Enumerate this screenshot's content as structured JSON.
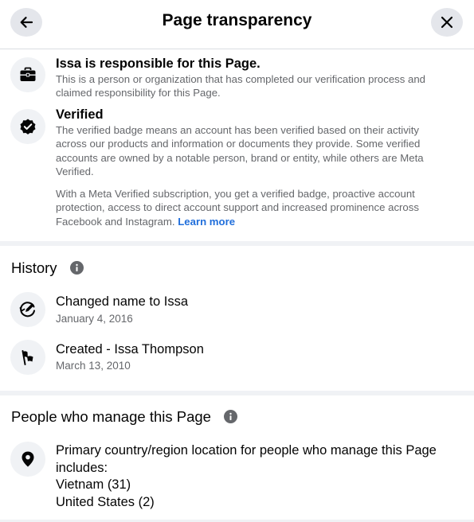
{
  "header": {
    "title": "Page transparency",
    "back_icon": "arrow-left-icon",
    "close_icon": "close-icon"
  },
  "responsibility": {
    "title": "Issa is responsible for this Page.",
    "description": "This is a person or organization that has completed our verification process and claimed responsibility for this Page.",
    "icon": "briefcase-icon"
  },
  "verified": {
    "title": "Verified",
    "description": "The verified badge means an account has been verified based on their activity across our products and information or documents they provide. Some verified accounts are owned by a notable person, brand or entity, while others are Meta Verified.",
    "meta_text": "With a Meta Verified subscription, you get a verified badge, proactive account protection, access to direct account support and increased prominence across Facebook and Instagram.",
    "learn_more": "Learn more",
    "icon": "verified-badge-icon",
    "link_color": "#216fdb"
  },
  "history": {
    "title": "History",
    "info_icon": "info-icon",
    "items": [
      {
        "title": "Changed name to Issa",
        "date": "January 4, 2016",
        "icon": "edit-name-icon"
      },
      {
        "title": "Created - Issa Thompson",
        "date": "March 13, 2010",
        "icon": "flag-icon"
      }
    ]
  },
  "managers": {
    "title": "People who manage this Page",
    "info_icon": "info-icon",
    "location_label": "Primary country/region location for people who manage this Page includes:",
    "countries": [
      "Vietnam (31)",
      "United States (2)"
    ],
    "icon": "location-pin-icon"
  }
}
